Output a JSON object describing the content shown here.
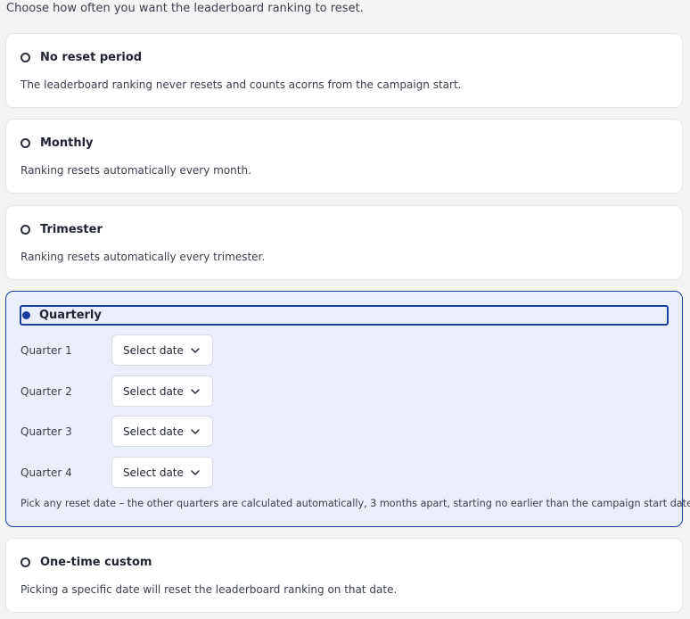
{
  "intro": "Choose how often you want the leaderboard ranking to reset.",
  "options": [
    {
      "label": "No reset period",
      "description": "The leaderboard ranking never resets and counts acorns from the campaign start."
    },
    {
      "label": "Monthly",
      "description": "Ranking resets automatically every month."
    },
    {
      "label": "Trimester",
      "description": "Ranking resets automatically every trimester."
    },
    {
      "label": "Quarterly"
    },
    {
      "label": "One-time custom",
      "description": "Picking a specific date will reset the leaderboard ranking on that date."
    }
  ],
  "quarterly": {
    "selected": true,
    "quarters": [
      {
        "label": "Quarter 1",
        "select": "Select date"
      },
      {
        "label": "Quarter 2",
        "select": "Select date"
      },
      {
        "label": "Quarter 3",
        "select": "Select date"
      },
      {
        "label": "Quarter 4",
        "select": "Select date"
      }
    ],
    "hint": "Pick any reset date – the other quarters are calculated automatically, 3 months apart, starting no earlier than the campaign start date."
  },
  "colors": {
    "accent": "#1c3d9e",
    "selected_bg": "#eaeefb"
  },
  "icons": {
    "radio": "radio-icon",
    "chevron": "chevron-down-icon"
  }
}
